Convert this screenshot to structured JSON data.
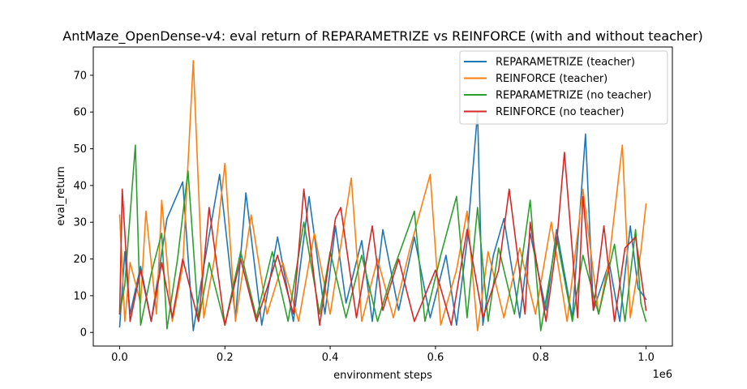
{
  "chart_data": {
    "type": "line",
    "title": "AntMaze_OpenDense-v4: eval return of REPARAMETRIZE vs REINFORCE (with and without teacher)",
    "xlabel": "environment steps",
    "ylabel": "eval_return",
    "x_offset_label": "1e6",
    "xlim": [
      -0.05,
      1.05
    ],
    "ylim": [
      -3.7,
      77.7
    ],
    "grid": false,
    "legend_position": "top-right",
    "x_ticks": [
      {
        "value": 0.0,
        "label": "0.0"
      },
      {
        "value": 0.2,
        "label": "0.2"
      },
      {
        "value": 0.4,
        "label": "0.4"
      },
      {
        "value": 0.6,
        "label": "0.6"
      },
      {
        "value": 0.8,
        "label": "0.8"
      },
      {
        "value": 1.0,
        "label": "1.0"
      }
    ],
    "y_ticks": [
      {
        "value": 0,
        "label": "0"
      },
      {
        "value": 10,
        "label": "10"
      },
      {
        "value": 20,
        "label": "20"
      },
      {
        "value": 30,
        "label": "30"
      },
      {
        "value": 40,
        "label": "40"
      },
      {
        "value": 50,
        "label": "50"
      },
      {
        "value": 60,
        "label": "60"
      },
      {
        "value": 70,
        "label": "70"
      }
    ],
    "series": [
      {
        "name": "REPARAMETRIZE (teacher)",
        "color": "#1f77b4",
        "x": [
          0.0,
          0.01,
          0.02,
          0.04,
          0.06,
          0.09,
          0.12,
          0.14,
          0.16,
          0.19,
          0.22,
          0.24,
          0.27,
          0.3,
          0.33,
          0.36,
          0.39,
          0.41,
          0.43,
          0.46,
          0.48,
          0.5,
          0.53,
          0.56,
          0.59,
          0.62,
          0.64,
          0.66,
          0.68,
          0.69,
          0.71,
          0.73,
          0.76,
          0.78,
          0.81,
          0.83,
          0.86,
          0.885,
          0.9,
          0.93,
          0.95,
          0.97,
          0.985,
          1.0
        ],
        "y": [
          1.5,
          22,
          5,
          18,
          3,
          31,
          41,
          0.5,
          18,
          43,
          4,
          38,
          2,
          26,
          3,
          37,
          5,
          29,
          8,
          25,
          3,
          28,
          6,
          26,
          4,
          21,
          2,
          25,
          60,
          2,
          21,
          31,
          4,
          27,
          6,
          28,
          4,
          54,
          6,
          19,
          3,
          29,
          12,
          9
        ]
      },
      {
        "name": "REINFORCE (teacher)",
        "color": "#ff7f0e",
        "x": [
          0.0,
          0.01,
          0.02,
          0.04,
          0.05,
          0.07,
          0.08,
          0.1,
          0.12,
          0.14,
          0.16,
          0.18,
          0.2,
          0.22,
          0.25,
          0.28,
          0.31,
          0.34,
          0.37,
          0.4,
          0.44,
          0.46,
          0.49,
          0.52,
          0.55,
          0.59,
          0.61,
          0.64,
          0.66,
          0.68,
          0.7,
          0.73,
          0.76,
          0.79,
          0.82,
          0.85,
          0.88,
          0.91,
          0.93,
          0.955,
          0.97,
          0.99,
          1.0
        ],
        "y": [
          32,
          3,
          19,
          8,
          33,
          5,
          36,
          3,
          18,
          74,
          4,
          20,
          46,
          3,
          32,
          5,
          19,
          3,
          27,
          5,
          42,
          3,
          20,
          4,
          22,
          43,
          2,
          17,
          33,
          0.5,
          22,
          4,
          23,
          5,
          30,
          3,
          39,
          5,
          20,
          51,
          4,
          22,
          35
        ]
      },
      {
        "name": "REPARAMETRIZE (no teacher)",
        "color": "#2ca02c",
        "x": [
          0.0,
          0.01,
          0.03,
          0.04,
          0.06,
          0.08,
          0.09,
          0.11,
          0.13,
          0.15,
          0.17,
          0.2,
          0.23,
          0.26,
          0.29,
          0.32,
          0.35,
          0.38,
          0.4,
          0.43,
          0.46,
          0.49,
          0.52,
          0.56,
          0.58,
          0.61,
          0.64,
          0.66,
          0.68,
          0.7,
          0.72,
          0.75,
          0.78,
          0.8,
          0.83,
          0.86,
          0.88,
          0.91,
          0.94,
          0.96,
          0.98,
          0.99,
          1.0
        ],
        "y": [
          5,
          13,
          51,
          2,
          16,
          27,
          1,
          20,
          44,
          3,
          19,
          2,
          22,
          4,
          22,
          3,
          30,
          5,
          22,
          4,
          21,
          3,
          17,
          33,
          3,
          21,
          37,
          4,
          34,
          3,
          23,
          5,
          36,
          0.5,
          26,
          3,
          21,
          5,
          24,
          3,
          28,
          8,
          3
        ]
      },
      {
        "name": "REINFORCE (no teacher)",
        "color": "#d62728",
        "x": [
          0.0,
          0.005,
          0.02,
          0.04,
          0.06,
          0.08,
          0.1,
          0.12,
          0.15,
          0.17,
          0.2,
          0.23,
          0.26,
          0.3,
          0.33,
          0.35,
          0.38,
          0.41,
          0.42,
          0.45,
          0.48,
          0.5,
          0.53,
          0.56,
          0.6,
          0.63,
          0.66,
          0.69,
          0.72,
          0.74,
          0.77,
          0.78,
          0.81,
          0.83,
          0.845,
          0.87,
          0.88,
          0.9,
          0.92,
          0.94,
          0.96,
          0.98,
          1.0
        ],
        "y": [
          5,
          39,
          3,
          17,
          3,
          19,
          4,
          20,
          3,
          34,
          2,
          20,
          3,
          21,
          5,
          39,
          2,
          31,
          34,
          4,
          29,
          6,
          20,
          3,
          17,
          2,
          28,
          4,
          17,
          39,
          5,
          30,
          3,
          24,
          49,
          4,
          37,
          6,
          29,
          3,
          23,
          26,
          6
        ]
      }
    ]
  }
}
